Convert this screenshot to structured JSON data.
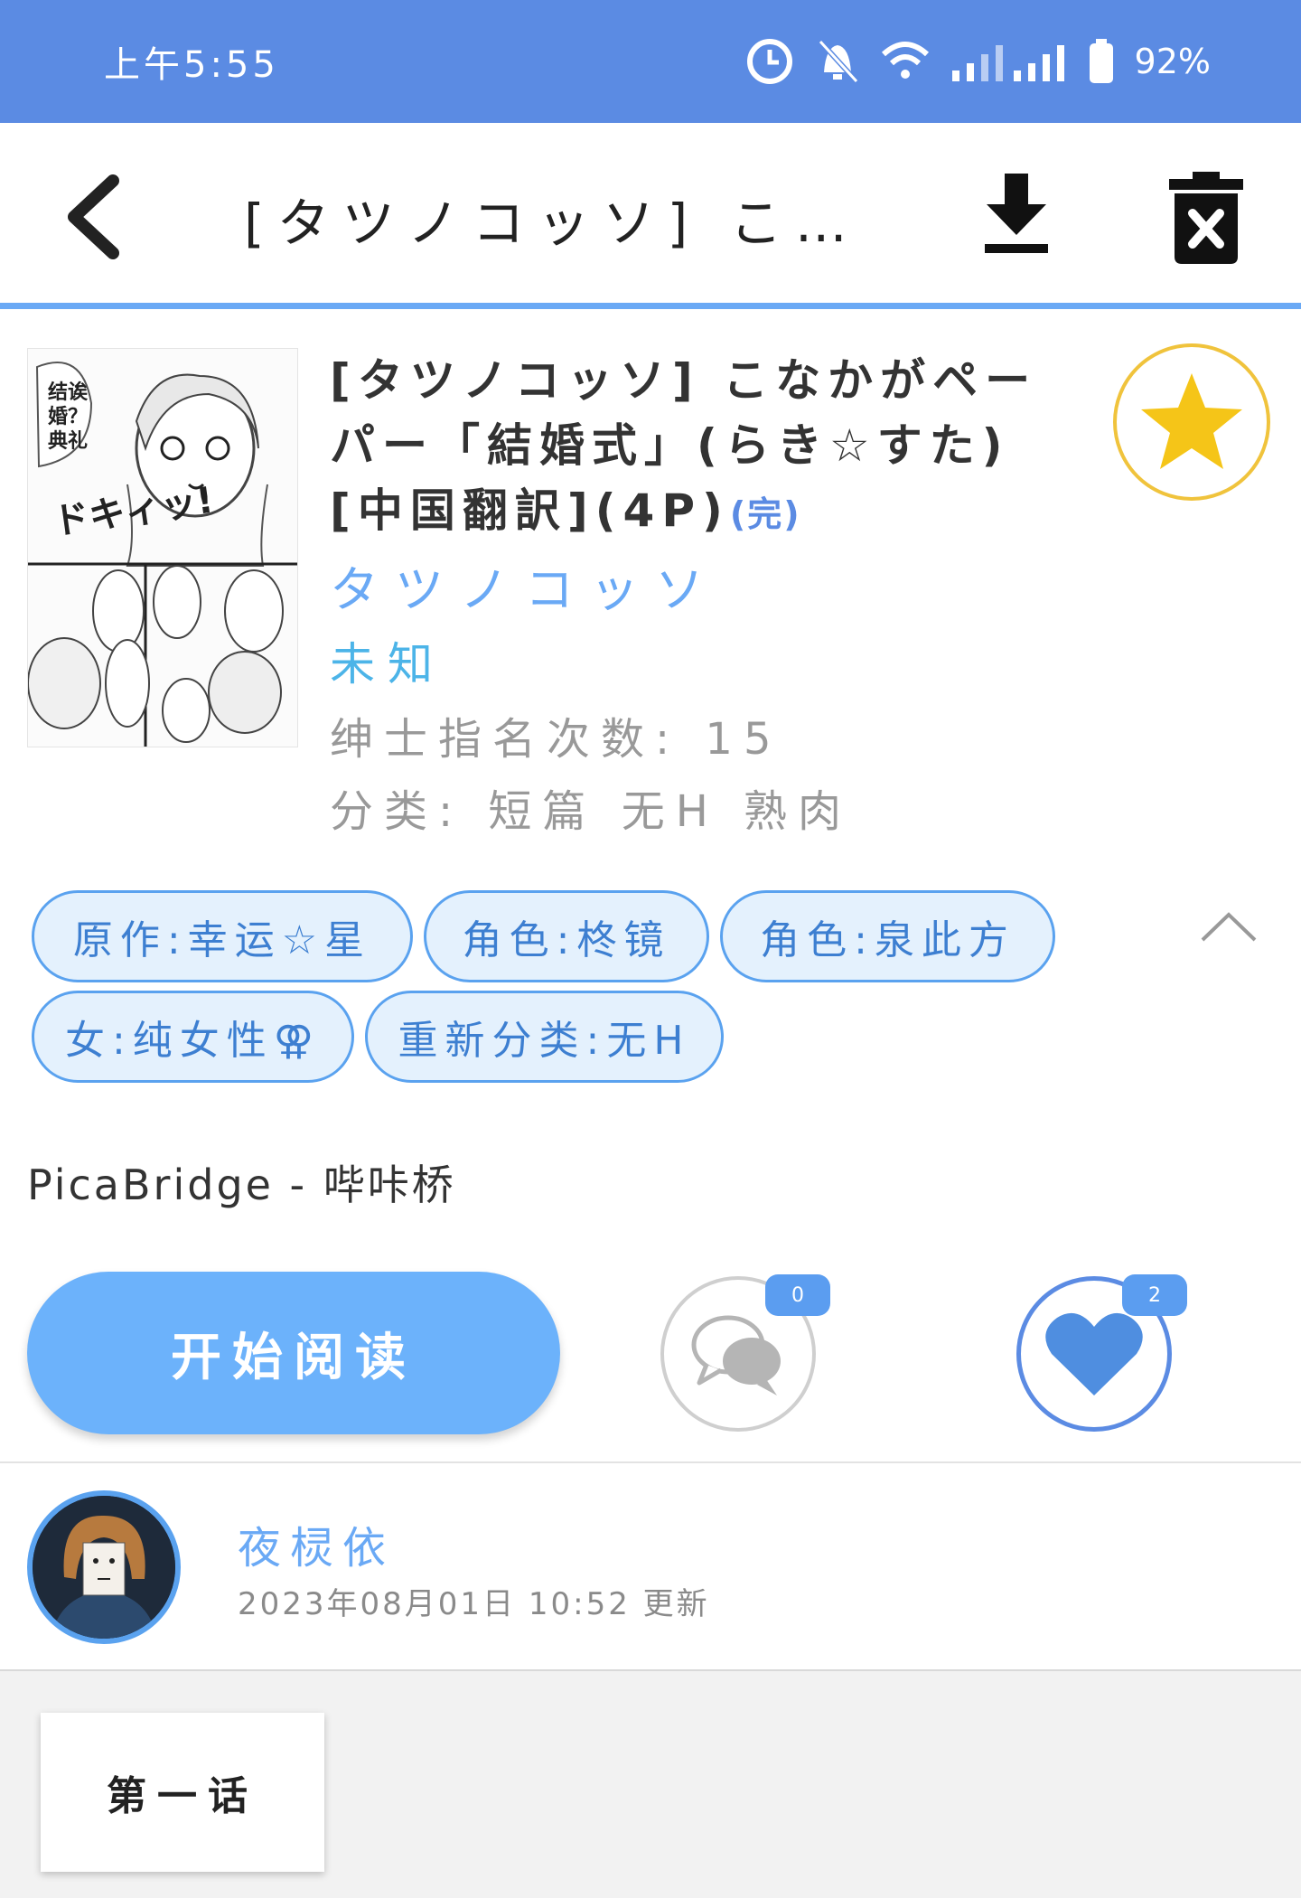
{
  "status_bar": {
    "time": "上午5:55",
    "battery": "92%"
  },
  "app_bar": {
    "title": "[タツノコッソ] こ…"
  },
  "comic": {
    "title": "[タツノコッソ] こなかがペーパー「結婚式」(らき☆すた) [中国翻訳](4P)",
    "finished_label": "(完)",
    "author": "タツノコッソ",
    "translator": "未知",
    "views_label": "绅士指名次数: 15",
    "categories_label": "分类: 短篇 无H 熟肉",
    "cover_text": {
      "bubble1": "诶？结婚典礼！?",
      "sfx": "ドキィッ!"
    }
  },
  "tags": [
    "原作:幸运☆星",
    "角色:柊镜",
    "角色:泉此方",
    "女:纯女性⚢",
    "重新分类:无H"
  ],
  "source": "PicaBridge - 哔咔桥",
  "actions": {
    "read_label": "开始阅读",
    "comments_count": "0",
    "likes_count": "2"
  },
  "uploader": {
    "name": "夜棂依",
    "update_time": "2023年08月01日 10:52 更新"
  },
  "episodes": [
    {
      "label": "第一话"
    }
  ],
  "colors": {
    "accent": "#5b8be3",
    "tag_border": "#5aa2ef",
    "star": "#f5c518"
  }
}
